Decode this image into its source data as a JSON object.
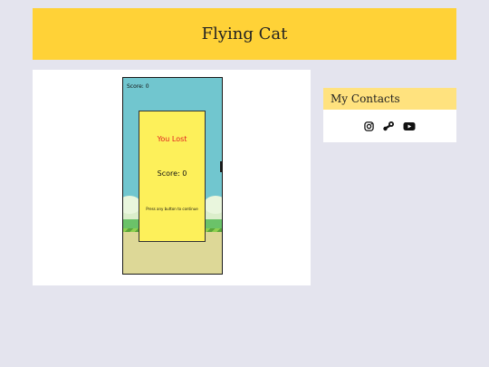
{
  "header": {
    "title": "Flying Cat"
  },
  "game": {
    "hud_score": "Score: 0",
    "modal": {
      "status": "You Lost",
      "score": "Score: 0",
      "hint": "Press any button to continue"
    }
  },
  "contacts": {
    "title": "My Contacts",
    "icons": [
      "instagram-icon",
      "steam-icon",
      "youtube-icon"
    ]
  },
  "colors": {
    "background": "#e4e4ee",
    "header": "#ffd237",
    "contacts_header": "#ffe27e",
    "sky": "#71c6cf",
    "modal": "#fdf05a",
    "lost_text": "#e02020"
  }
}
